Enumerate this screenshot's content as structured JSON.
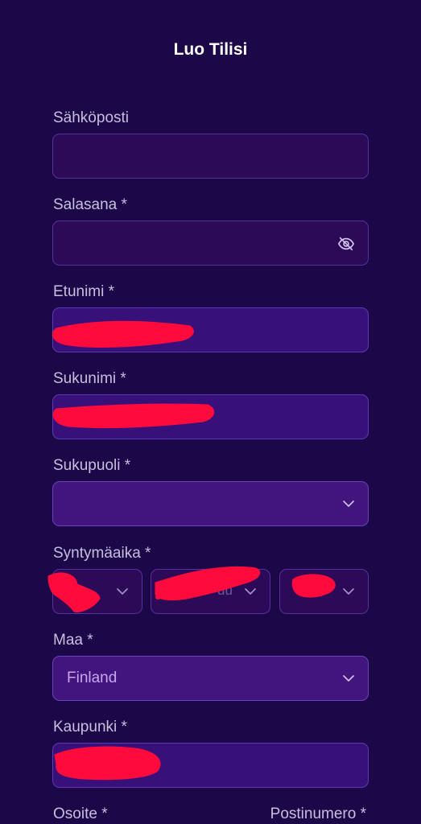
{
  "title": "Luo Tilisi",
  "fields": {
    "email": {
      "label": "Sähköposti",
      "value": ""
    },
    "password": {
      "label": "Salasana *",
      "value": "",
      "icon": "eye-slash-icon"
    },
    "first_name": {
      "label": "Etunimi *"
    },
    "last_name": {
      "label": "Sukunimi *"
    },
    "gender": {
      "label": "Sukupuoli *",
      "value": "",
      "icon": "chevron-down-icon"
    },
    "birthdate": {
      "label": "Syntymäaika *",
      "day_value": "",
      "month_value": "uu",
      "year_value": "",
      "icon": "chevron-down-icon"
    },
    "country": {
      "label": "Maa *",
      "value": "Finland",
      "icon": "chevron-down-icon"
    },
    "city": {
      "label": "Kaupunki *"
    },
    "address": {
      "label": "Osoite *"
    },
    "postal_code": {
      "label": "Postinumero *"
    }
  },
  "colors": {
    "background": "#1c0848",
    "field_dark": "#2c0a58",
    "field_purple": "#38107a",
    "field_select": "#42147e",
    "field_border": "#53329a",
    "redaction": "#ff0a3c",
    "label": "#c8bedd",
    "selected_value": "#c6a6ec"
  }
}
